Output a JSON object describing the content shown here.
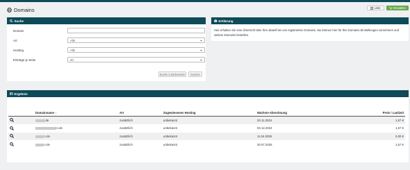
{
  "header": {
    "title": "Domains",
    "liste_label": "Liste",
    "verwalten_label": "Verwalten"
  },
  "search": {
    "title": "Suche",
    "domain_label": "Domain",
    "domain_value": "",
    "art_label": "Art",
    "art_value": "Alle",
    "hosting_label": "Hosting",
    "hosting_value": "Alle",
    "per_page_label": "Einträge je Seite",
    "per_page_value": "20",
    "reset_button": "Suche zurücksetzen",
    "search_button": "Suchen"
  },
  "info": {
    "title": "Erklärung",
    "text": "Hier erhalten Sie eine Übersicht über Ihre aktuell bei uns registrierten Domains. Sie können hier für Ihre Domains Einstellungen vornehmen und weitere Domains bestellen."
  },
  "results": {
    "title": "Ergebnis",
    "columns": [
      "Domainname",
      "Art",
      "Zugewiesenes Hosting",
      "Nächste Abrechnung",
      "Preis / Laufzeit"
    ],
    "sort_indicator": "↑",
    "rows": [
      {
        "domain": "de",
        "art": "zusätzlich",
        "hosting": "unbekannt",
        "billing": "20.11.2024",
        "price": "1,57 €"
      },
      {
        "domain": "n.de",
        "art": "zusätzlich",
        "hosting": "unbekannt",
        "billing": "03.12.2024",
        "price": "1,57 €"
      },
      {
        "domain": "n.de",
        "art": "zusätzlich",
        "hosting": "unbekannt",
        "billing": "11.04.2025",
        "price": "0,00 €"
      },
      {
        "domain": "n.de",
        "art": "zusätzlich",
        "hosting": "unbekannt",
        "billing": "30.07.2025",
        "price": "1,57 €"
      }
    ]
  },
  "colors": {
    "primary": "#0e4a58",
    "accent_green": "#6aa84f",
    "background": "#eef0f1"
  },
  "icons": [
    "globe-icon",
    "list-icon",
    "cart-icon",
    "search-icon",
    "info-icon",
    "table-icon",
    "magnifier-icon"
  ]
}
